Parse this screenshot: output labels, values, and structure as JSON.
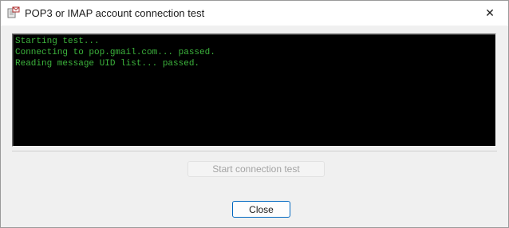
{
  "window": {
    "title": "POP3 or IMAP account connection test",
    "close_glyph": "✕",
    "icon": "mail-server-icon"
  },
  "console": {
    "text_color": "#3cb33c",
    "background": "#000000",
    "lines": [
      "Starting test...",
      "Connecting to pop.gmail.com... passed.",
      "Reading message UID list... passed."
    ]
  },
  "buttons": {
    "start_label": "Start connection test",
    "start_enabled": false,
    "close_label": "Close"
  },
  "colors": {
    "accent": "#0067c0",
    "disabled_text": "#a3a3a3"
  }
}
